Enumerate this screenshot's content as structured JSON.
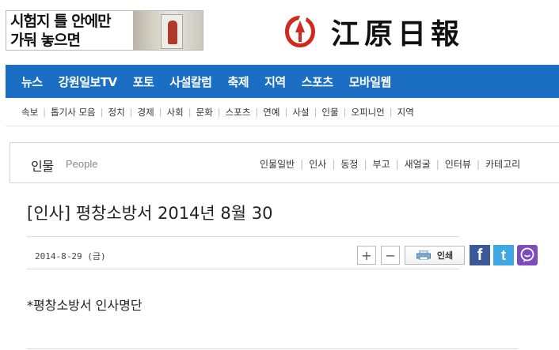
{
  "ad": {
    "line1": "시험지 틀 안에만",
    "line2": "가둬 놓으면"
  },
  "logo": {
    "text": "江原日報"
  },
  "nav": {
    "items": [
      "뉴스",
      "강원일보TV",
      "포토",
      "사설칼럼",
      "축제",
      "지역",
      "스포츠",
      "모바일웹"
    ]
  },
  "subnav": {
    "items": [
      "속보",
      "톱기사 모음",
      "정치",
      "경제",
      "사회",
      "문화",
      "스포츠",
      "연예",
      "사설",
      "인물",
      "오피니언",
      "지역"
    ]
  },
  "section": {
    "title": "인물",
    "subtitle": "People",
    "links": [
      "인물일반",
      "인사",
      "동정",
      "부고",
      "새얼굴",
      "인터뷰",
      "카테고리"
    ]
  },
  "article": {
    "headline": "[인사] 평창소방서 2014년 8월 30",
    "date": "2014-8-29 (금)",
    "body": "*평창소방서 인사명단"
  },
  "tools": {
    "zoom_in": "+",
    "zoom_out": "−",
    "print_label": "인쇄",
    "facebook_glyph": "f",
    "twitter_glyph": "t"
  },
  "colors": {
    "nav": "#1a6fc4",
    "facebook": "#3b5998",
    "twitter": "#3fa7e3",
    "kakaostory": "#7d4cbc",
    "logo_mark": "#d02a1e"
  }
}
